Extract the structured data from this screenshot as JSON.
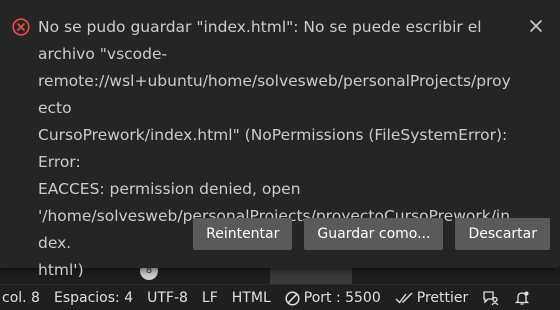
{
  "notification": {
    "message": "No se pudo guardar \"index.html\": No se puede escribir el archivo \"vscode-\nremote://wsl+ubuntu/home/solvesweb/personalProjects/proyecto\nCursoPrework/index.html\" (NoPermissions (FileSystemError): Error:\nEACCES: permission denied, open\n'/home/solvesweb/personalProjects/proyectoCursoPrework/index.\nhtml')",
    "severity_icon": "error-icon",
    "close_icon": "close-icon",
    "buttons": {
      "retry": "Reintentar",
      "save_as": "Guardar como...",
      "discard": "Descartar"
    }
  },
  "editor": {
    "scroll_badge": "8"
  },
  "statusbar": {
    "column": "col. 8",
    "spaces": "Espacios: 4",
    "encoding": "UTF-8",
    "eol": "LF",
    "language": "HTML",
    "port": "Port : 5500",
    "prettier": "Prettier"
  },
  "colors": {
    "error": "#f14c4c",
    "dialog_bg": "#252526",
    "button_bg": "#5a5a5a",
    "text": "#cccccc"
  }
}
